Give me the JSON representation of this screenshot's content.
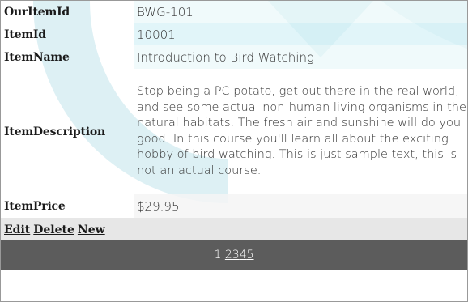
{
  "colors": {
    "pager_background": "#5c5c5c",
    "action_row_background": "#e4e4e4",
    "watermark": "#dff1f4"
  },
  "fields": [
    {
      "label": "OurItemId",
      "value": "BWG-101"
    },
    {
      "label": "ItemId",
      "value": "10001"
    },
    {
      "label": "ItemName",
      "value": "Introduction to Bird Watching"
    },
    {
      "label": "ItemDescription",
      "value": "Stop being a PC potato, get out there in the real world, and see some actual non-human living organisms in the natural habitats. The fresh air and sunshine will do you good. In this course you'll learn all about the exciting hobby of bird watching. This is just sample text, this is not an actual course."
    },
    {
      "label": "ItemPrice",
      "value": "$29.95"
    }
  ],
  "actions": {
    "edit": "Edit",
    "delete": "Delete",
    "new": "New"
  },
  "pager": {
    "current": "1",
    "pages": [
      "2",
      "3",
      "4",
      "5"
    ]
  }
}
